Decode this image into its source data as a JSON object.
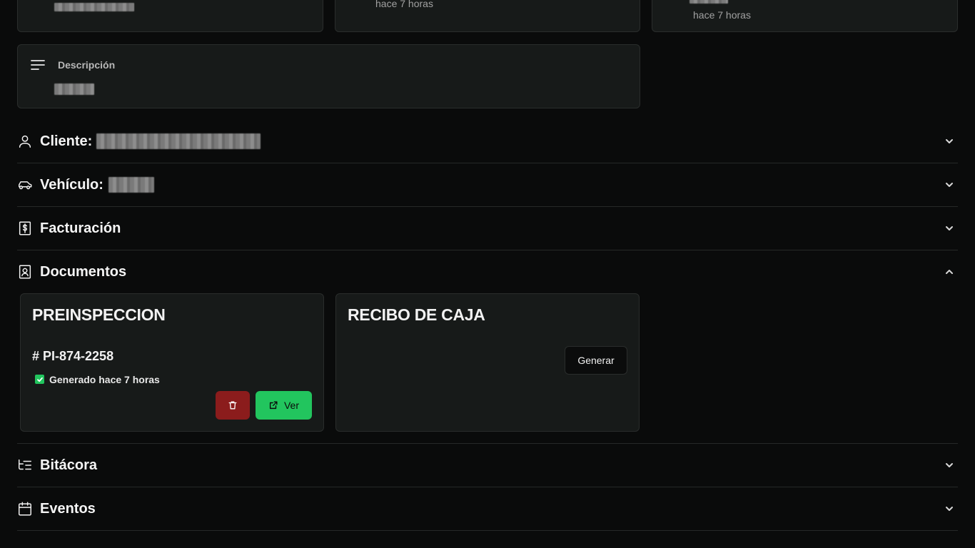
{
  "top_cards": [
    {
      "time": ""
    },
    {
      "time": "hace 7 horas"
    },
    {
      "time": "hace 7 horas"
    }
  ],
  "descripcion": {
    "label": "Descripción"
  },
  "sections": {
    "cliente": {
      "label": "Cliente:"
    },
    "vehiculo": {
      "label": "Vehículo:"
    },
    "facturacion": {
      "label": "Facturación"
    },
    "documentos": {
      "label": "Documentos"
    },
    "bitacora": {
      "label": "Bitácora"
    },
    "eventos": {
      "label": "Eventos"
    }
  },
  "documents": {
    "preinspeccion": {
      "title": "PREINSPECCION",
      "number": "# PI-874-2258",
      "status": "Generado hace 7 horas",
      "view_label": "Ver"
    },
    "recibo": {
      "title": "RECIBO DE CAJA",
      "generate_label": "Generar"
    }
  },
  "colors": {
    "background": "#0a0b0b",
    "card": "#171a19",
    "delete_button": "#8b1c1c",
    "view_button": "#22c55e",
    "check": "#22c55e"
  }
}
